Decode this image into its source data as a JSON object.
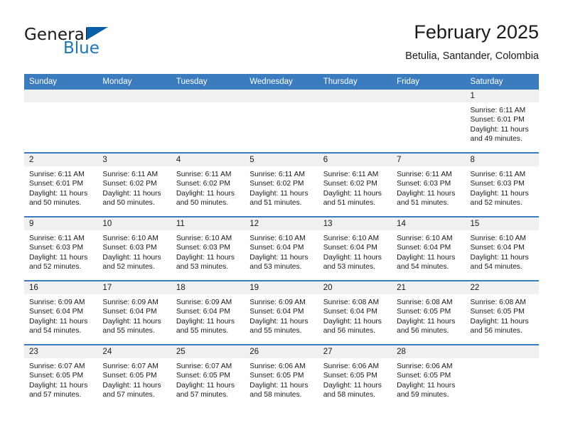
{
  "logo": {
    "word_top": "General",
    "word_bottom": "Blue",
    "triangle_color": "#0b5ea8",
    "blue_color": "#1b75bb"
  },
  "header": {
    "title": "February 2025",
    "subtitle": "Betulia, Santander, Colombia"
  },
  "theme": {
    "header_bg": "#3a7cbe",
    "daynum_bg": "#f0f0f0",
    "row_separator": "#3a7cbe",
    "text": "#1a1a1a"
  },
  "weekdays": [
    "Sunday",
    "Monday",
    "Tuesday",
    "Wednesday",
    "Thursday",
    "Friday",
    "Saturday"
  ],
  "labels": {
    "sunrise": "Sunrise:",
    "sunset": "Sunset:",
    "daylight": "Daylight:"
  },
  "weeks": [
    [
      {
        "blank": true
      },
      {
        "blank": true
      },
      {
        "blank": true
      },
      {
        "blank": true
      },
      {
        "blank": true
      },
      {
        "blank": true
      },
      {
        "day": "1",
        "sunrise": "Sunrise: 6:11 AM",
        "sunset": "Sunset: 6:01 PM",
        "daylight": "Daylight: 11 hours and 49 minutes."
      }
    ],
    [
      {
        "day": "2",
        "sunrise": "Sunrise: 6:11 AM",
        "sunset": "Sunset: 6:01 PM",
        "daylight": "Daylight: 11 hours and 50 minutes."
      },
      {
        "day": "3",
        "sunrise": "Sunrise: 6:11 AM",
        "sunset": "Sunset: 6:02 PM",
        "daylight": "Daylight: 11 hours and 50 minutes."
      },
      {
        "day": "4",
        "sunrise": "Sunrise: 6:11 AM",
        "sunset": "Sunset: 6:02 PM",
        "daylight": "Daylight: 11 hours and 50 minutes."
      },
      {
        "day": "5",
        "sunrise": "Sunrise: 6:11 AM",
        "sunset": "Sunset: 6:02 PM",
        "daylight": "Daylight: 11 hours and 51 minutes."
      },
      {
        "day": "6",
        "sunrise": "Sunrise: 6:11 AM",
        "sunset": "Sunset: 6:02 PM",
        "daylight": "Daylight: 11 hours and 51 minutes."
      },
      {
        "day": "7",
        "sunrise": "Sunrise: 6:11 AM",
        "sunset": "Sunset: 6:03 PM",
        "daylight": "Daylight: 11 hours and 51 minutes."
      },
      {
        "day": "8",
        "sunrise": "Sunrise: 6:11 AM",
        "sunset": "Sunset: 6:03 PM",
        "daylight": "Daylight: 11 hours and 52 minutes."
      }
    ],
    [
      {
        "day": "9",
        "sunrise": "Sunrise: 6:11 AM",
        "sunset": "Sunset: 6:03 PM",
        "daylight": "Daylight: 11 hours and 52 minutes."
      },
      {
        "day": "10",
        "sunrise": "Sunrise: 6:10 AM",
        "sunset": "Sunset: 6:03 PM",
        "daylight": "Daylight: 11 hours and 52 minutes."
      },
      {
        "day": "11",
        "sunrise": "Sunrise: 6:10 AM",
        "sunset": "Sunset: 6:03 PM",
        "daylight": "Daylight: 11 hours and 53 minutes."
      },
      {
        "day": "12",
        "sunrise": "Sunrise: 6:10 AM",
        "sunset": "Sunset: 6:04 PM",
        "daylight": "Daylight: 11 hours and 53 minutes."
      },
      {
        "day": "13",
        "sunrise": "Sunrise: 6:10 AM",
        "sunset": "Sunset: 6:04 PM",
        "daylight": "Daylight: 11 hours and 53 minutes."
      },
      {
        "day": "14",
        "sunrise": "Sunrise: 6:10 AM",
        "sunset": "Sunset: 6:04 PM",
        "daylight": "Daylight: 11 hours and 54 minutes."
      },
      {
        "day": "15",
        "sunrise": "Sunrise: 6:10 AM",
        "sunset": "Sunset: 6:04 PM",
        "daylight": "Daylight: 11 hours and 54 minutes."
      }
    ],
    [
      {
        "day": "16",
        "sunrise": "Sunrise: 6:09 AM",
        "sunset": "Sunset: 6:04 PM",
        "daylight": "Daylight: 11 hours and 54 minutes."
      },
      {
        "day": "17",
        "sunrise": "Sunrise: 6:09 AM",
        "sunset": "Sunset: 6:04 PM",
        "daylight": "Daylight: 11 hours and 55 minutes."
      },
      {
        "day": "18",
        "sunrise": "Sunrise: 6:09 AM",
        "sunset": "Sunset: 6:04 PM",
        "daylight": "Daylight: 11 hours and 55 minutes."
      },
      {
        "day": "19",
        "sunrise": "Sunrise: 6:09 AM",
        "sunset": "Sunset: 6:04 PM",
        "daylight": "Daylight: 11 hours and 55 minutes."
      },
      {
        "day": "20",
        "sunrise": "Sunrise: 6:08 AM",
        "sunset": "Sunset: 6:04 PM",
        "daylight": "Daylight: 11 hours and 56 minutes."
      },
      {
        "day": "21",
        "sunrise": "Sunrise: 6:08 AM",
        "sunset": "Sunset: 6:05 PM",
        "daylight": "Daylight: 11 hours and 56 minutes."
      },
      {
        "day": "22",
        "sunrise": "Sunrise: 6:08 AM",
        "sunset": "Sunset: 6:05 PM",
        "daylight": "Daylight: 11 hours and 56 minutes."
      }
    ],
    [
      {
        "day": "23",
        "sunrise": "Sunrise: 6:07 AM",
        "sunset": "Sunset: 6:05 PM",
        "daylight": "Daylight: 11 hours and 57 minutes."
      },
      {
        "day": "24",
        "sunrise": "Sunrise: 6:07 AM",
        "sunset": "Sunset: 6:05 PM",
        "daylight": "Daylight: 11 hours and 57 minutes."
      },
      {
        "day": "25",
        "sunrise": "Sunrise: 6:07 AM",
        "sunset": "Sunset: 6:05 PM",
        "daylight": "Daylight: 11 hours and 57 minutes."
      },
      {
        "day": "26",
        "sunrise": "Sunrise: 6:06 AM",
        "sunset": "Sunset: 6:05 PM",
        "daylight": "Daylight: 11 hours and 58 minutes."
      },
      {
        "day": "27",
        "sunrise": "Sunrise: 6:06 AM",
        "sunset": "Sunset: 6:05 PM",
        "daylight": "Daylight: 11 hours and 58 minutes."
      },
      {
        "day": "28",
        "sunrise": "Sunrise: 6:06 AM",
        "sunset": "Sunset: 6:05 PM",
        "daylight": "Daylight: 11 hours and 59 minutes."
      },
      {
        "blank": true
      }
    ]
  ]
}
